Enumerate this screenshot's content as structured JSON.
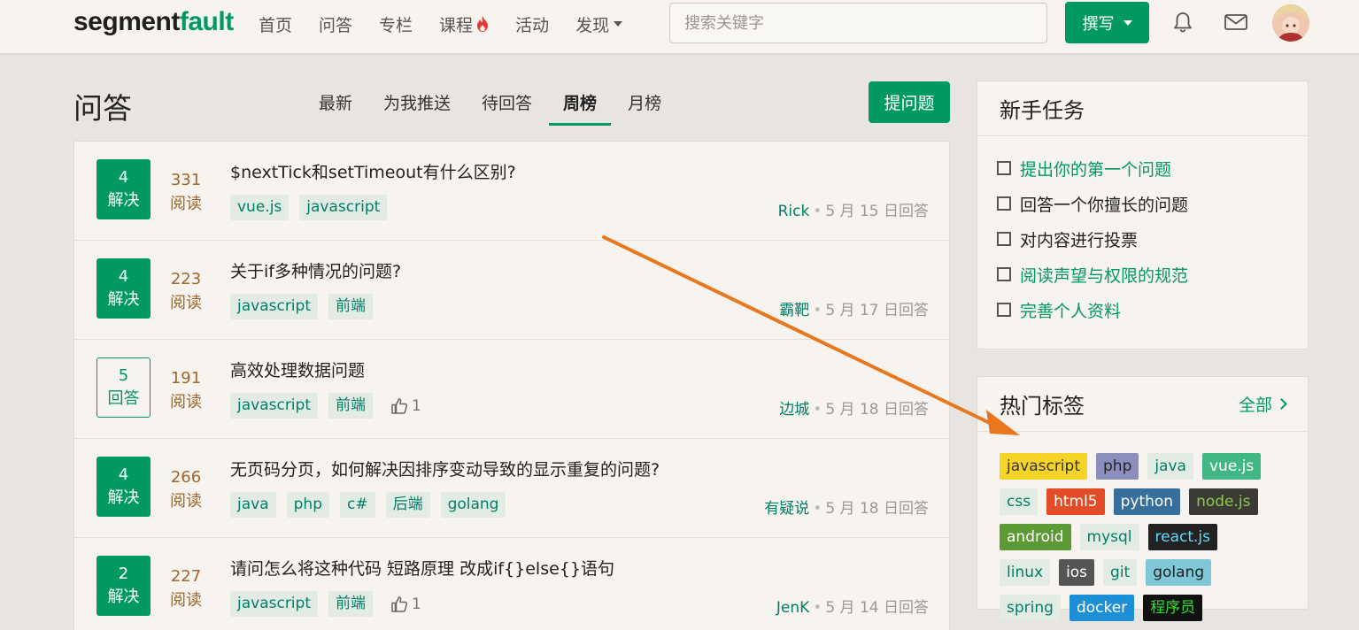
{
  "header": {
    "logo_dark": "segment",
    "logo_green": "fault",
    "nav": [
      "首页",
      "问答",
      "专栏",
      "课程",
      "活动",
      "发现"
    ],
    "search_placeholder": "搜索关键字",
    "write_label": "撰写"
  },
  "main": {
    "title": "问答",
    "tabs": [
      "最新",
      "为我推送",
      "待回答",
      "周榜",
      "月榜"
    ],
    "active_tab": "周榜",
    "ask_label": "提问题",
    "questions": [
      {
        "count": "4",
        "status": "解决",
        "views": "331",
        "views_label": "阅读",
        "title": "$nextTick和setTimeout有什么区别?",
        "tags": [
          "vue.js",
          "javascript"
        ],
        "likes": "",
        "author": "Rick",
        "date": "5 月 15 日回答"
      },
      {
        "count": "4",
        "status": "解决",
        "views": "223",
        "views_label": "阅读",
        "title": "关于if多种情况的问题?",
        "tags": [
          "javascript",
          "前端"
        ],
        "likes": "",
        "author": "霸靶",
        "date": "5 月 17 日回答"
      },
      {
        "count": "5",
        "status": "回答",
        "views": "191",
        "views_label": "阅读",
        "title": "高效处理数据问题",
        "tags": [
          "javascript",
          "前端"
        ],
        "likes": "1",
        "author": "边城",
        "date": "5 月 18 日回答"
      },
      {
        "count": "4",
        "status": "解决",
        "views": "266",
        "views_label": "阅读",
        "title": "无页码分页，如何解决因排序变动导致的显示重复的问题?",
        "tags": [
          "java",
          "php",
          "c#",
          "后端",
          "golang"
        ],
        "likes": "",
        "author": "有疑说",
        "date": "5 月 18 日回答"
      },
      {
        "count": "2",
        "status": "解决",
        "views": "227",
        "views_label": "阅读",
        "title": "请问怎么将这种代码 短路原理 改成if{}else{}语句",
        "tags": [
          "javascript",
          "前端"
        ],
        "likes": "1",
        "author": "JenK",
        "date": "5 月 14 日回答"
      }
    ]
  },
  "sidebar": {
    "tasks_title": "新手任务",
    "tasks": [
      {
        "label": "提出你的第一个问题",
        "link": true
      },
      {
        "label": "回答一个你擅长的问题",
        "link": false
      },
      {
        "label": "对内容进行投票",
        "link": false
      },
      {
        "label": "阅读声望与权限的规范",
        "link": true
      },
      {
        "label": "完善个人资料",
        "link": true
      }
    ],
    "hot_title": "热门标签",
    "hot_all": "全部",
    "hot_tags": [
      {
        "label": "javascript",
        "bg": "#f5d327",
        "fg": "#333333"
      },
      {
        "label": "php",
        "bg": "#8a8fbd",
        "fg": "#222222"
      },
      {
        "label": "java",
        "bg": "#e2ece5",
        "fg": "#017e66"
      },
      {
        "label": "vue.js",
        "bg": "#41b883",
        "fg": "#ffffff"
      },
      {
        "label": "css",
        "bg": "#e2ece5",
        "fg": "#017e66"
      },
      {
        "label": "html5",
        "bg": "#e34c26",
        "fg": "#ffffff"
      },
      {
        "label": "python",
        "bg": "#366e9c",
        "fg": "#ffffff"
      },
      {
        "label": "node.js",
        "bg": "#3c3a35",
        "fg": "#8cc84b"
      },
      {
        "label": "android",
        "bg": "#5c9a35",
        "fg": "#ffffff"
      },
      {
        "label": "mysql",
        "bg": "#e2ece5",
        "fg": "#017e66"
      },
      {
        "label": "react.js",
        "bg": "#222222",
        "fg": "#61dafb"
      },
      {
        "label": "linux",
        "bg": "#e2ece5",
        "fg": "#017e66"
      },
      {
        "label": "ios",
        "bg": "#555555",
        "fg": "#ffffff"
      },
      {
        "label": "git",
        "bg": "#e2ece5",
        "fg": "#017e66"
      },
      {
        "label": "golang",
        "bg": "#7fc8d8",
        "fg": "#222222"
      },
      {
        "label": "spring",
        "bg": "#e2ece5",
        "fg": "#017e66"
      },
      {
        "label": "docker",
        "bg": "#1d8fd6",
        "fg": "#ffffff"
      },
      {
        "label": "程序员",
        "bg": "#111111",
        "fg": "#2ee02e"
      }
    ]
  }
}
